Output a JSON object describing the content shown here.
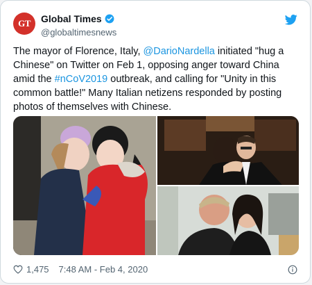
{
  "tweet": {
    "avatar_text": "GT",
    "display_name": "Global Times",
    "handle": "@globaltimesnews",
    "text_parts": {
      "p1": "The mayor of Florence, Italy, ",
      "mention": "@DarioNardella",
      "p2": " initiated \"hug a Chinese\" on Twitter on Feb 1, opposing anger toward China amid the ",
      "hashtag": "#nCoV2019",
      "p3": " outbreak, and calling for \"Unity in this common battle!\" Many Italian netizens responded by posting photos of themselves with Chinese."
    },
    "likes": "1,475",
    "timestamp": "7:48 AM - Feb 4, 2020"
  },
  "colors": {
    "brand_red": "#d3312a",
    "link_blue": "#1b95e0",
    "twitter_blue": "#1da1f2",
    "muted": "#536471"
  },
  "icons": {
    "verified": "verified-badge-icon",
    "bird": "twitter-bird-icon",
    "like": "heart-icon",
    "info": "info-icon"
  }
}
